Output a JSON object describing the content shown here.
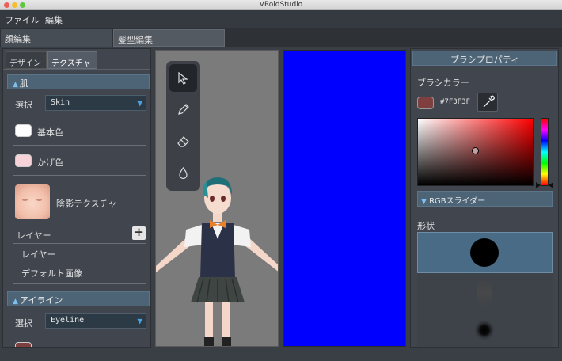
{
  "window": {
    "title": "VRoidStudio"
  },
  "menu": [
    "ファイル",
    "編集"
  ],
  "main_tabs": [
    {
      "label": "顔編集",
      "active": true
    },
    {
      "label": "髪型編集",
      "active": false
    }
  ],
  "left_panel": {
    "tabs": [
      {
        "label": "デザイン",
        "active": false
      },
      {
        "label": "テクスチャ",
        "active": true
      }
    ],
    "skin_section": {
      "title": "肌",
      "select_label": "選択",
      "select_value": "Skin",
      "items": [
        {
          "label": "基本色",
          "color": "#ffffff"
        },
        {
          "label": "かげ色",
          "color": "#f7d3d9"
        }
      ],
      "shadow_texture_label": "陰影テクスチャ",
      "layer_header": "レイヤー",
      "layers": [
        "レイヤー",
        "デフォルト画像"
      ]
    },
    "eyeline_section": {
      "title": "アイライン",
      "select_label": "選択",
      "select_value": "Eyeline"
    }
  },
  "right_panel": {
    "title": "ブラシプロパティ",
    "brush_color_label": "ブラシカラー",
    "brush_color_hex": "#7F3F3F",
    "rgb_slider_label": "RGBスライダー",
    "shape_label": "形状"
  },
  "colors": {
    "accent": "#4c6476",
    "canvas_2d": "#0000ff",
    "brush_color": "#7f3f3f"
  },
  "icons": [
    "cursor-arrow-icon",
    "pen-icon",
    "eraser-icon",
    "fill-drop-icon",
    "eyedropper-icon",
    "plus-icon"
  ]
}
